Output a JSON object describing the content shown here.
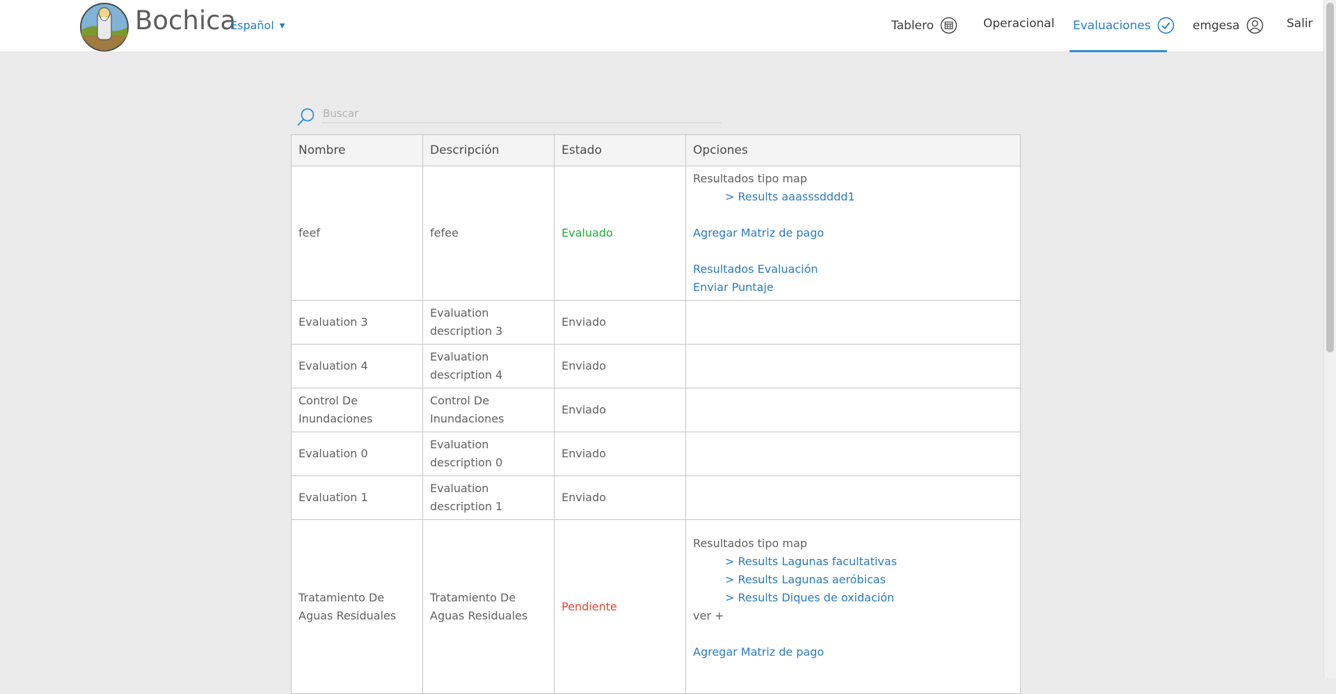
{
  "header": {
    "brand": "Bochica",
    "language": "Español",
    "nav": {
      "tablero": "Tablero",
      "operacional": "Operacional",
      "evaluaciones": "Evaluaciones",
      "user": "emgesa",
      "salir": "Salir"
    },
    "accent_color": "#2480c7"
  },
  "search": {
    "placeholder": "Buscar"
  },
  "table": {
    "headers": [
      "Nombre",
      "Descripción",
      "Estado",
      "Opciones"
    ],
    "rows": [
      {
        "name": "feef",
        "description": "fefee",
        "status": "Evaluado",
        "options": {
          "results_title": "Resultados tipo map",
          "results": [
            "> Results aaasssdddd1"
          ],
          "add_matrix": "Agregar Matriz de pago",
          "results_eval": "Resultados Evaluación",
          "send_score": "Enviar Puntaje"
        }
      },
      {
        "name": "Evaluation 3",
        "description": "Evaluation description 3",
        "status": "Enviado"
      },
      {
        "name": "Evaluation 4",
        "description": "Evaluation description 4",
        "status": "Enviado"
      },
      {
        "name": "Control De Inundaciones",
        "description": "Control De Inundaciones",
        "status": "Enviado"
      },
      {
        "name": "Evaluation 0",
        "description": "Evaluation description 0",
        "status": "Enviado"
      },
      {
        "name": "Evaluation 1",
        "description": "Evaluation description 1",
        "status": "Enviado"
      },
      {
        "name": "Tratamiento De Aguas Residuales",
        "description": "Tratamiento De Aguas Residuales",
        "status": "Pendiente",
        "options": {
          "results_title": "Resultados tipo map",
          "results": [
            "> Results Lagunas facultativas",
            "> Results Lagunas aeróbicas",
            "> Results Diques de oxidación"
          ],
          "more": "ver +",
          "add_matrix": "Agregar Matriz de pago"
        }
      }
    ]
  },
  "status_colors": {
    "evaluado": "#1fae3a",
    "pendiente": "#e2462f"
  }
}
